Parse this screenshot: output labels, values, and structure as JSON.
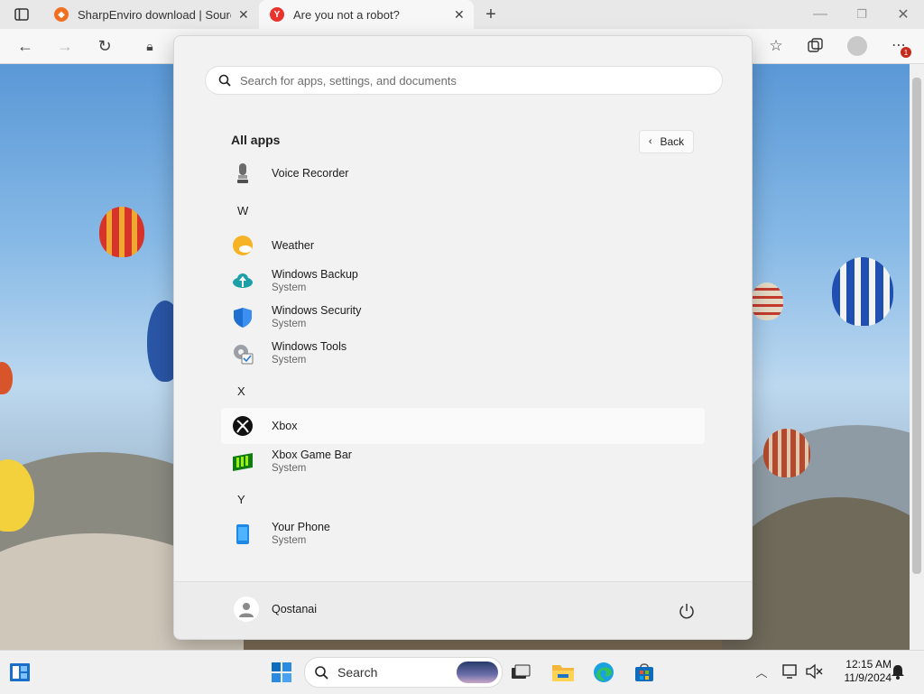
{
  "browser": {
    "tabs": [
      {
        "title": "SharpEnviro download | SourceF",
        "icon": "sourceforge-icon"
      },
      {
        "title": "Are you not a robot?",
        "icon": "yandex-icon"
      }
    ],
    "notification_count": "1"
  },
  "start_menu": {
    "search_placeholder": "Search for apps, settings, and documents",
    "all_apps_label": "All apps",
    "back_label": "Back",
    "apps": [
      {
        "type": "app",
        "name": "Voice Recorder",
        "icon": "microphone-icon"
      },
      {
        "type": "letter",
        "name": "W"
      },
      {
        "type": "app",
        "name": "Weather",
        "icon": "weather-icon"
      },
      {
        "type": "app",
        "name": "Windows Backup",
        "sub": "System",
        "icon": "backup-cloud-icon"
      },
      {
        "type": "app",
        "name": "Windows Security",
        "sub": "System",
        "icon": "shield-icon"
      },
      {
        "type": "app",
        "name": "Windows Tools",
        "sub": "System",
        "icon": "tools-gear-icon"
      },
      {
        "type": "letter",
        "name": "X"
      },
      {
        "type": "app",
        "name": "Xbox",
        "icon": "xbox-icon",
        "hovered": true
      },
      {
        "type": "app",
        "name": "Xbox Game Bar",
        "sub": "System",
        "icon": "xbox-game-bar-icon"
      },
      {
        "type": "letter",
        "name": "Y"
      },
      {
        "type": "app",
        "name": "Your Phone",
        "sub": "System",
        "icon": "phone-icon"
      }
    ],
    "user_name": "Qostanai"
  },
  "taskbar": {
    "search_label": "Search",
    "time": "12:15 AM",
    "date": "11/9/2024"
  }
}
